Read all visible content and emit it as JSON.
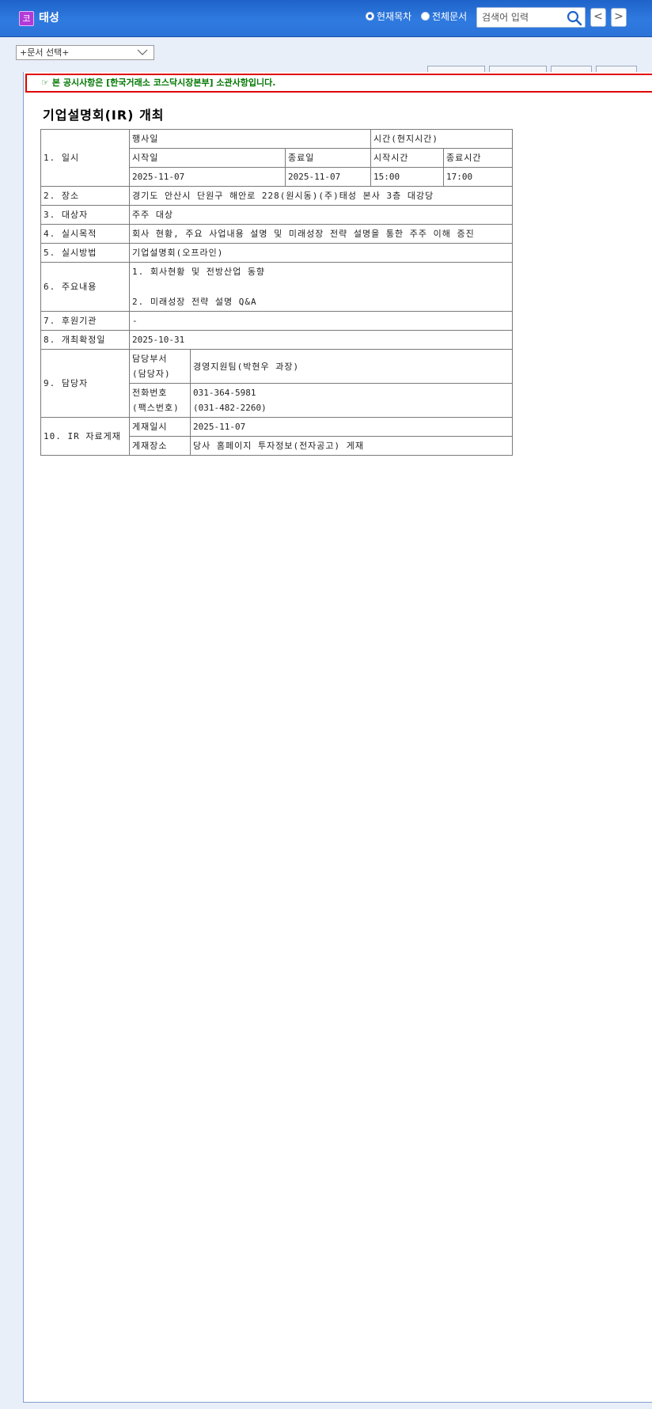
{
  "header": {
    "corp_icon_char": "코",
    "corp_name": "태성",
    "radio_current": "현재목차",
    "radio_all": "전체문서",
    "search_placeholder": "검색어 입력",
    "prev": "<",
    "next": ">"
  },
  "doc_select": {
    "value": "+문서 선택+"
  },
  "notice": {
    "icon": "pointing-hand-icon",
    "prefix": "본 공시사항은 ",
    "market": "[한국거래소 코스닥시장본부]",
    "suffix": " 소관사항입니다."
  },
  "document": {
    "title": "기업설명회(IR) 개최",
    "row1": {
      "label": "1. 일시",
      "event_day_header": "행사일",
      "time_header": "시간(현지시간)",
      "start_day_label": "시작일",
      "end_day_label": "종료일",
      "start_time_label": "시작시간",
      "end_time_label": "종료시간",
      "start_day": "2025-11-07",
      "end_day": "2025-11-07",
      "start_time": "15:00",
      "end_time": "17:00"
    },
    "row2": {
      "label": "2. 장소",
      "value": "경기도 안산시 단원구 해안로 228(원시동)(주)태성 본사 3층 대강당"
    },
    "row3": {
      "label": "3. 대상자",
      "value": "주주 대상"
    },
    "row4": {
      "label": "4. 실시목적",
      "value": "회사 현황, 주요 사업내용 설명 및 미래성장 전략 설명을 통한 주주 이해 증진"
    },
    "row5": {
      "label": "5. 실시방법",
      "value": "기업설명회(오프라인)"
    },
    "row6": {
      "label": "6. 주요내용",
      "line1": "1. 회사현황 및 전방산업 동향",
      "line2": "2. 미래성장 전략 설명 Q&A"
    },
    "row7": {
      "label": "7. 후원기관",
      "value": "-"
    },
    "row8": {
      "label": "8. 개최확정일",
      "value": "2025-10-31"
    },
    "row9": {
      "label": "9. 담당자",
      "dept_label_1": "담당부서",
      "dept_label_2": "(담당자)",
      "dept_value": "경영지원팀(박현우 과장)",
      "phone_label_1": "전화번호",
      "phone_label_2": "(팩스번호)",
      "phone_value": "031-364-5981",
      "fax_value": "(031-482-2260)"
    },
    "row10": {
      "label": "10. IR 자료게재",
      "date_label": "게재일시",
      "date_value": "2025-11-07",
      "place_label": "게재장소",
      "place_value": "당사 홈페이지 투자정보(전자공고) 게재"
    }
  }
}
